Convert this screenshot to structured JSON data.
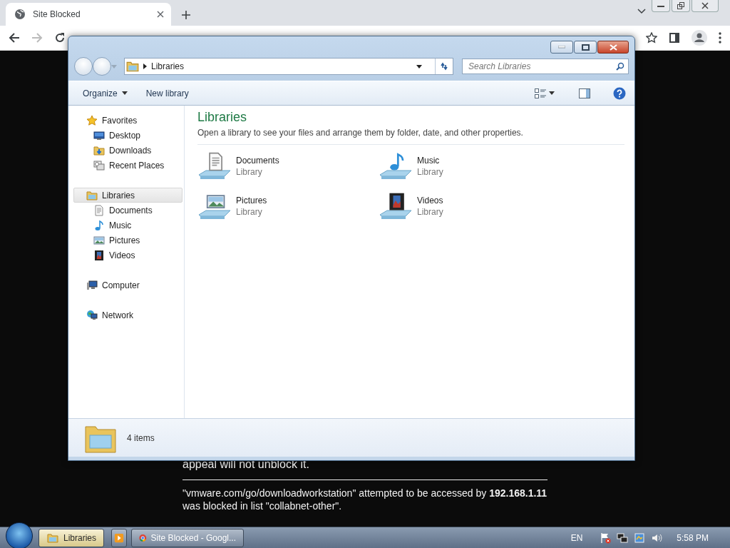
{
  "browser": {
    "tab": {
      "title": "Site Blocked",
      "selected": true
    },
    "page": {
      "lines": [
        "appeal will not unblock it."
      ],
      "message": "\"vmware.com/go/downloadworkstation\" attempted to be accessed by **192.168.1.11** was blocked in list \"collabnet-other\"."
    }
  },
  "explorer": {
    "address": "Libraries",
    "search": {
      "placeholder": "Search Libraries"
    },
    "commands": [
      "Organize",
      "New library"
    ],
    "sidebar": [
      {
        "label": "Favorites",
        "kind": "favorites",
        "selected": false,
        "children": [
          {
            "label": "Desktop",
            "kind": "desktop",
            "selected": false
          },
          {
            "label": "Downloads",
            "kind": "downloads",
            "selected": false
          },
          {
            "label": "Recent Places",
            "kind": "recent",
            "selected": false
          }
        ]
      },
      {
        "label": "Libraries",
        "kind": "libraries",
        "selected": true,
        "children": [
          {
            "label": "Documents",
            "kind": "documents",
            "selected": false
          },
          {
            "label": "Music",
            "kind": "music",
            "selected": false
          },
          {
            "label": "Pictures",
            "kind": "pictures",
            "selected": false
          },
          {
            "label": "Videos",
            "kind": "videos",
            "selected": false
          }
        ]
      },
      {
        "label": "Computer",
        "kind": "computer",
        "selected": false
      },
      {
        "label": "Network",
        "kind": "network",
        "selected": false
      }
    ],
    "heading": "Libraries",
    "subtitle": "Open a library to see your files and arrange them by folder, date, and other properties.",
    "items": [
      {
        "name": "Documents",
        "type": "Library",
        "kind": "documents"
      },
      {
        "name": "Music",
        "type": "Library",
        "kind": "music"
      },
      {
        "name": "Pictures",
        "type": "Library",
        "kind": "pictures"
      },
      {
        "name": "Videos",
        "type": "Library",
        "kind": "videos"
      }
    ],
    "status": "4 items"
  },
  "taskbar": {
    "buttons": [
      {
        "label": "Libraries",
        "kind": "explorer",
        "selected": true
      },
      {
        "kind": "media",
        "selected": false
      },
      {
        "label": "Site Blocked - Googl...",
        "kind": "chrome",
        "selected": false
      }
    ],
    "language": "EN",
    "clock": "5:58 PM"
  }
}
